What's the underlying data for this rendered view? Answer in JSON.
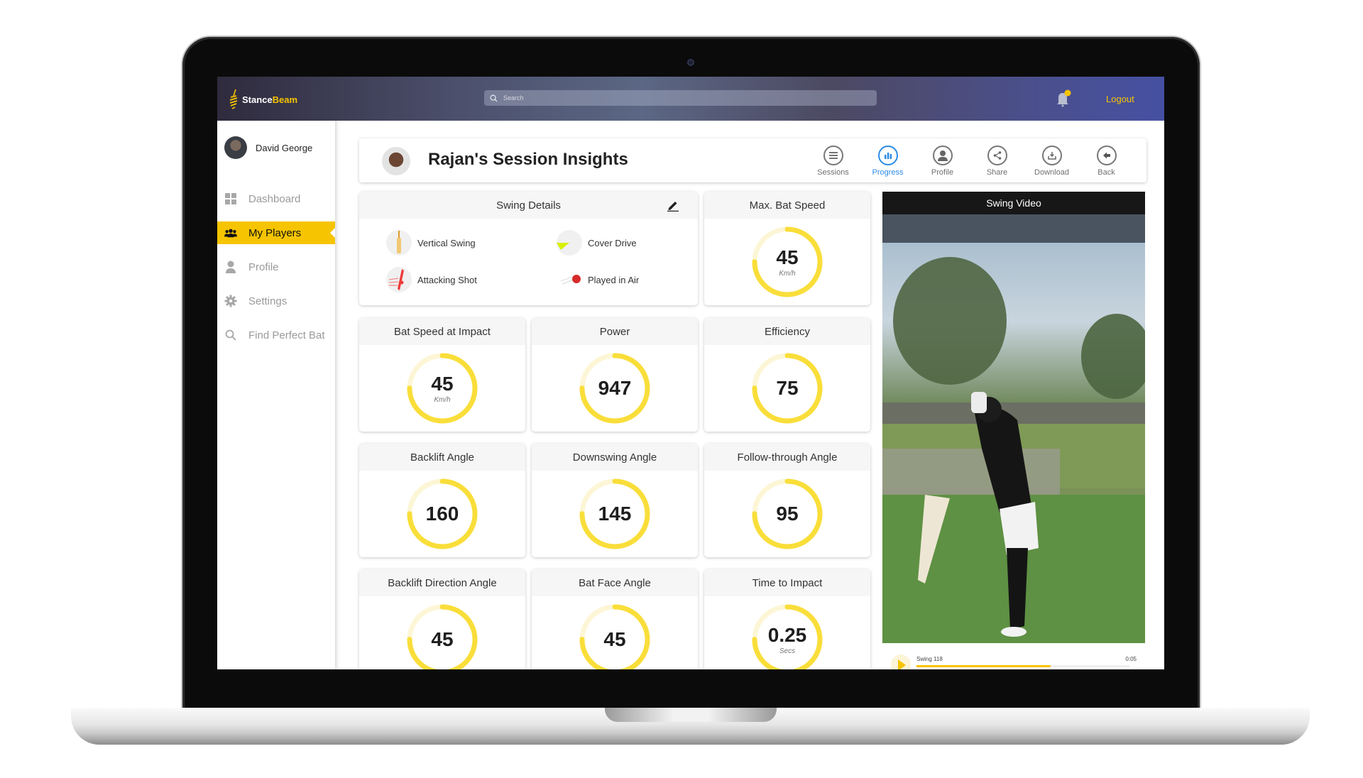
{
  "app": {
    "brand_part1": "Stance",
    "brand_part2": "Beam",
    "accent_color": "#f6c400"
  },
  "header": {
    "search_placeholder": "Search",
    "logout_label": "Logout",
    "notification_badge": true
  },
  "sidebar": {
    "user_name": "David George",
    "items": [
      {
        "label": "Dashboard",
        "icon": "grid-icon",
        "active": false
      },
      {
        "label": "My Players",
        "icon": "group-icon",
        "active": true
      },
      {
        "label": "Profile",
        "icon": "person-icon",
        "active": false
      },
      {
        "label": "Settings",
        "icon": "gear-icon",
        "active": false
      },
      {
        "label": "Find Perfect Bat",
        "icon": "search-icon",
        "active": false
      }
    ]
  },
  "page": {
    "title": "Rajan's Session Insights",
    "actions": [
      {
        "label": "Sessions",
        "icon": "list-icon",
        "active": false
      },
      {
        "label": "Progress",
        "icon": "bar-chart-icon",
        "active": true
      },
      {
        "label": "Profile",
        "icon": "person-icon",
        "active": false
      },
      {
        "label": "Share",
        "icon": "share-icon",
        "active": false
      },
      {
        "label": "Download",
        "icon": "download-icon",
        "active": false
      },
      {
        "label": "Back",
        "icon": "arrow-left-icon",
        "active": false
      }
    ]
  },
  "swing_details": {
    "title": "Swing Details",
    "items": [
      {
        "label": "Vertical Swing",
        "icon": "bat-icon"
      },
      {
        "label": "Cover Drive",
        "icon": "cover-drive-icon"
      },
      {
        "label": "Attacking Shot",
        "icon": "attacking-shot-icon"
      },
      {
        "label": "Played in Air",
        "icon": "ball-in-air-icon"
      }
    ]
  },
  "metrics": [
    {
      "title": "Max. Bat Speed",
      "value": "45",
      "unit": "Km/h",
      "fill": 0.75
    },
    {
      "title": "Bat Speed at Impact",
      "value": "45",
      "unit": "Km/h",
      "fill": 0.75
    },
    {
      "title": "Power",
      "value": "947",
      "unit": "",
      "fill": 0.75
    },
    {
      "title": "Efficiency",
      "value": "75",
      "unit": "",
      "fill": 0.75
    },
    {
      "title": "Backlift Angle",
      "value": "160",
      "unit": "",
      "fill": 0.75
    },
    {
      "title": "Downswing Angle",
      "value": "145",
      "unit": "",
      "fill": 0.75
    },
    {
      "title": "Follow-through Angle",
      "value": "95",
      "unit": "",
      "fill": 0.75
    },
    {
      "title": "Backlift Direction Angle",
      "value": "45",
      "unit": "",
      "fill": 0.75
    },
    {
      "title": "Bat Face Angle",
      "value": "45",
      "unit": "",
      "fill": 0.75
    },
    {
      "title": "Time to Impact",
      "value": "0.25",
      "unit": "Secs",
      "fill": 0.75
    }
  ],
  "video": {
    "title": "Swing Video",
    "clip_name": "Swing 118",
    "duration": "0:05",
    "progress": 0.63
  }
}
